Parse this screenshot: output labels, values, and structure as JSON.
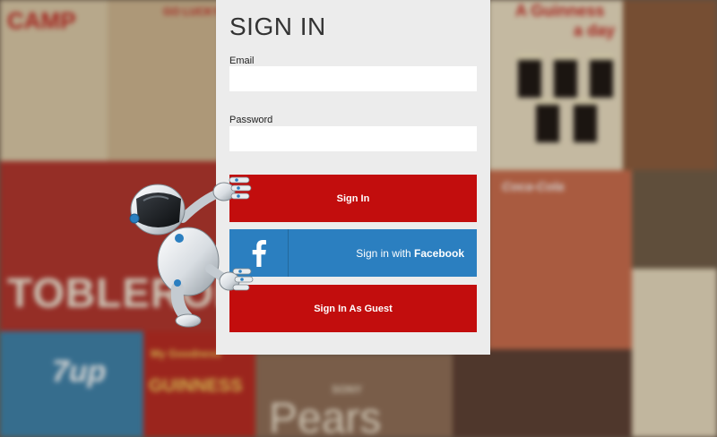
{
  "page": {
    "title": "SIGN IN"
  },
  "form": {
    "email_label": "Email",
    "email_value": "",
    "password_label": "Password",
    "password_value": ""
  },
  "buttons": {
    "sign_in": "Sign In",
    "facebook_prefix": "Sign in with ",
    "facebook_brand": "Facebook",
    "guest": "Sign In As Guest"
  },
  "background": {
    "poster_texts": [
      "CAMP",
      "GO LUCKY",
      "A Guinness",
      "a day",
      "TOBLERONE",
      "7up",
      "My Goodness",
      "GUINNESS",
      "SONY",
      "Pears",
      "Coca-Cola"
    ]
  },
  "colors": {
    "panel": "#ececec",
    "primary_red": "#c20d0d",
    "facebook_blue": "#2b7fc0",
    "title_text": "#333333"
  },
  "icons": {
    "facebook": "facebook-icon",
    "mascot": "robot-mascot"
  }
}
